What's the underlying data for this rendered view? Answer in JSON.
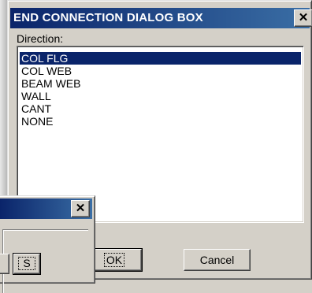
{
  "main_dialog": {
    "title": "END CONNECTION DIALOG BOX",
    "close_glyph": "✕",
    "direction_label": "Direction:",
    "list_items": [
      "COL FLG",
      "COL WEB",
      "BEAM WEB",
      "WALL",
      "CANT",
      "NONE"
    ],
    "selected_index": 0,
    "ok_label": "OK",
    "cancel_label": "Cancel"
  },
  "secondary_dialog": {
    "title": "",
    "close_glyph": "✕",
    "s_button_label": "S"
  },
  "colors": {
    "title_bar_start": "#0a246a",
    "title_bar_end": "#3a6ea5",
    "face": "#d4d0c8",
    "selection": "#0a246a"
  }
}
